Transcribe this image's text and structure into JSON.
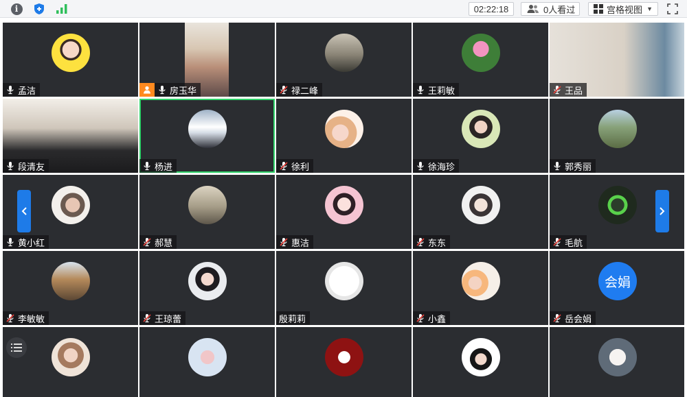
{
  "toolbar": {
    "info_icon": "info-icon",
    "shield_icon": "shield-icon",
    "signal_icon": "signal-icon",
    "timer": "02:22:18",
    "viewers_label": "0人看过",
    "layout_label": "宫格视图",
    "fullscreen_icon": "fullscreen-icon"
  },
  "colors": {
    "tile_bg": "#2b2d31",
    "active_border": "#2fd46a",
    "nav_arrow": "#1e7be8",
    "host_badge": "#ff8a1f",
    "muted_mic": "#e2403a",
    "text_avatar": "#1f7cf0"
  },
  "participants": [
    {
      "name": "孟洁",
      "mic": "on"
    },
    {
      "name": "房玉华",
      "mic": "on",
      "badge": "host-person-icon",
      "video": true
    },
    {
      "name": "禄二峰",
      "mic": "muted"
    },
    {
      "name": "王莉敏",
      "mic": "on"
    },
    {
      "name": "王品",
      "mic": "muted",
      "video": true
    },
    {
      "name": "段清友",
      "mic": "on",
      "video": true
    },
    {
      "name": "杨进",
      "mic": "on",
      "active": true
    },
    {
      "name": "徐利",
      "mic": "muted"
    },
    {
      "name": "徐海珍",
      "mic": "on"
    },
    {
      "name": "郭秀丽",
      "mic": "on"
    },
    {
      "name": "黄小红",
      "mic": "on"
    },
    {
      "name": "郝慧",
      "mic": "muted"
    },
    {
      "name": "惠洁",
      "mic": "muted"
    },
    {
      "name": "东东",
      "mic": "muted"
    },
    {
      "name": "毛航",
      "mic": "muted"
    },
    {
      "name": "李敏敏",
      "mic": "muted"
    },
    {
      "name": "王琼蕾",
      "mic": "muted"
    },
    {
      "name": "殷莉莉",
      "mic": "none"
    },
    {
      "name": "小鑫",
      "mic": "muted"
    },
    {
      "name": "岳会娟",
      "mic": "muted",
      "avatar_text": "会娟"
    },
    {
      "name": "",
      "mic": "none"
    },
    {
      "name": "",
      "mic": "none"
    },
    {
      "name": "",
      "mic": "none"
    },
    {
      "name": "",
      "mic": "none"
    },
    {
      "name": "",
      "mic": "none"
    }
  ],
  "nav": {
    "left_icon": "chevron-left-icon",
    "right_icon": "chevron-right-icon",
    "list_icon": "list-icon"
  }
}
